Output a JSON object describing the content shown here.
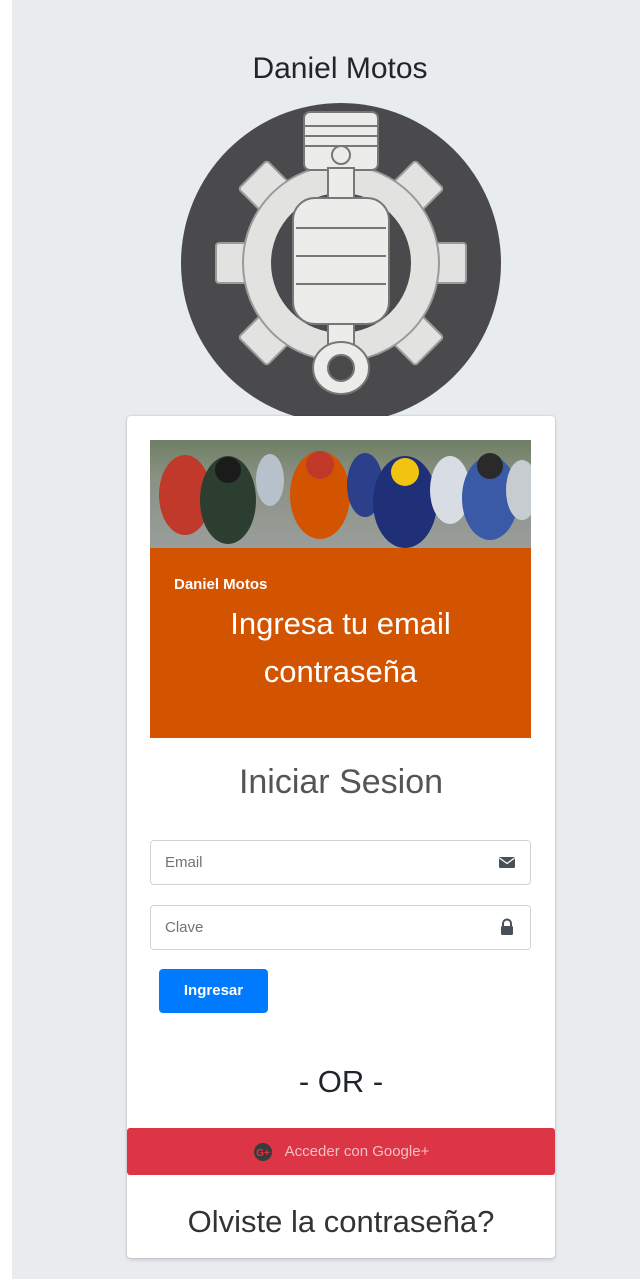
{
  "header": {
    "title": "Daniel Motos",
    "logo": "gear-piston-fist-logo"
  },
  "hero": {
    "photo": "motorcycle-race-photo",
    "brand": "Daniel Motos",
    "headline_line1": "Ingresa tu email",
    "headline_line2": "contraseña",
    "accent_color": "#d35400"
  },
  "login": {
    "title": "Iniciar Sesion",
    "email": {
      "placeholder": "Email",
      "value": "",
      "icon": "envelope-icon"
    },
    "password": {
      "placeholder": "Clave",
      "value": "",
      "icon": "lock-icon"
    },
    "submit_label": "Ingresar",
    "submit_color": "#007bff"
  },
  "separator": "- OR -",
  "google": {
    "label": "Acceder con Google+",
    "icon": "google-plus-icon",
    "color": "#dc3545"
  },
  "forgot_label": "Olviste la contraseña?"
}
